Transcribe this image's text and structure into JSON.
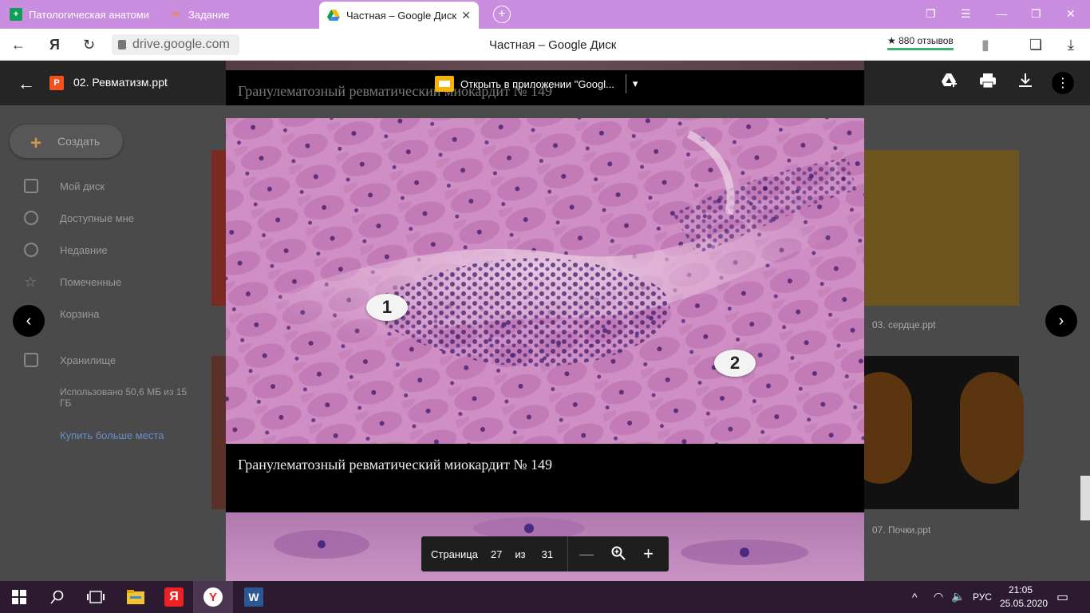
{
  "browser": {
    "tabs": [
      {
        "label": "Патологическая анатоми",
        "active": false
      },
      {
        "label": "Задание",
        "active": false
      },
      {
        "label": "Частная – Google Диск",
        "active": true
      }
    ],
    "url": "drive.google.com",
    "page_title": "Частная – Google Диск",
    "reviews": "880 отзывов"
  },
  "drive": {
    "create_label": "Создать",
    "sidebar": [
      {
        "label": "Мой диск"
      },
      {
        "label": "Доступные мне"
      },
      {
        "label": "Недавние"
      },
      {
        "label": "Помеченные"
      },
      {
        "label": "Корзина"
      },
      {
        "label": "Хранилище"
      }
    ],
    "storage_used": "Использовано 50,6 МБ из 15 ГБ",
    "buy_more": "Купить больше места",
    "files": [
      {
        "name": "03. сердце.ppt"
      },
      {
        "name": "07. Почки.ppt"
      }
    ]
  },
  "viewer": {
    "file_name": "02. Ревматизм.ppt",
    "file_badge": "P",
    "open_with": "Открыть в приложении \"Googl...",
    "slide_caption_top": "Гранулематозный ревматический миокардит № 149",
    "slide_caption": "Гранулематозный ревматический миокардит № 149",
    "label_1": "1",
    "label_2": "2"
  },
  "pager": {
    "page_label": "Страница",
    "current": "27",
    "of_label": "из",
    "total": "31"
  },
  "taskbar": {
    "lang": "РУС",
    "time": "21:05",
    "date": "25.05.2020"
  }
}
